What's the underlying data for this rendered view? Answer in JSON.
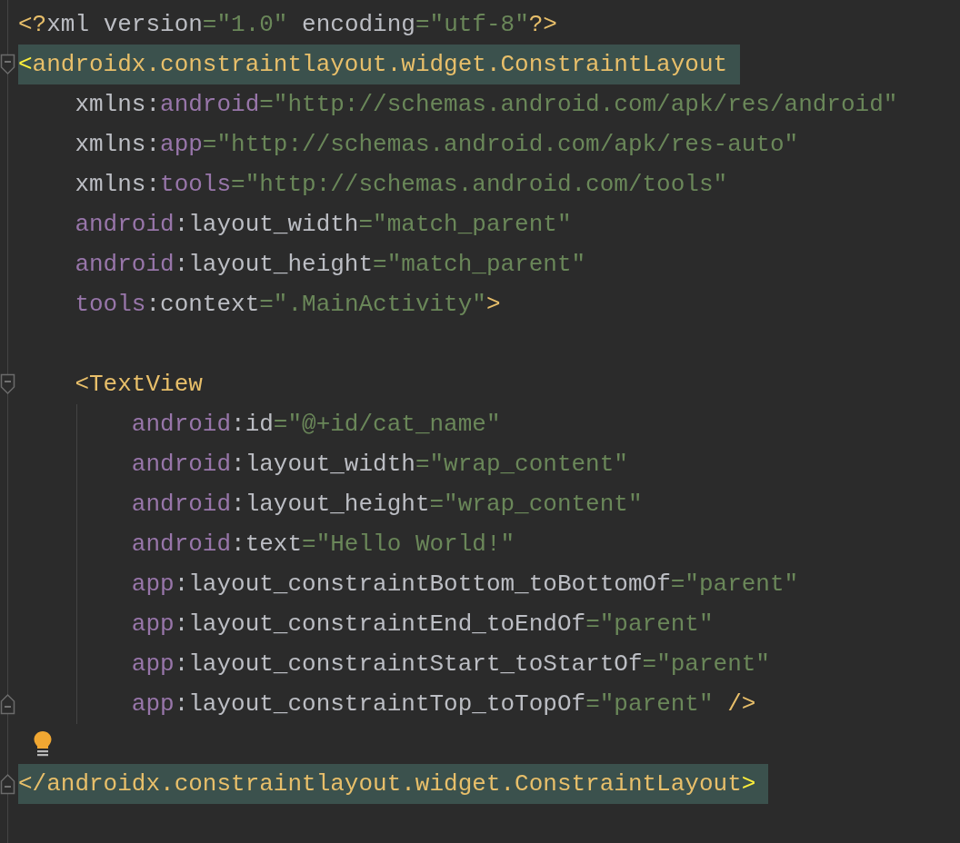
{
  "lines": [
    {
      "tokens": [
        {
          "kind": "tag",
          "text": "<?"
        },
        {
          "kind": "name",
          "text": "xml version"
        },
        {
          "kind": "value",
          "text": "=\"1.0\""
        },
        {
          "kind": "name",
          "text": " encoding"
        },
        {
          "kind": "value",
          "text": "=\"utf-8\""
        },
        {
          "kind": "tag",
          "text": "?>"
        }
      ],
      "highlighted": false,
      "kind": "plain"
    },
    {
      "tokens": [
        {
          "kind": "brace",
          "text": "<"
        },
        {
          "kind": "tag",
          "text": "androidx.constraintlayout.widget.ConstraintLayout"
        }
      ],
      "highlighted": true,
      "kind": "opening"
    },
    {
      "tokens": [
        {
          "kind": "name",
          "text": "    xmlns:"
        },
        {
          "kind": "ns",
          "text": "android"
        },
        {
          "kind": "value",
          "text": "=\"http://schemas.android.com/apk/res/android\""
        }
      ],
      "highlighted": false
    },
    {
      "tokens": [
        {
          "kind": "name",
          "text": "    xmlns:"
        },
        {
          "kind": "ns",
          "text": "app"
        },
        {
          "kind": "value",
          "text": "=\"http://schemas.android.com/apk/res-auto\""
        }
      ],
      "highlighted": false
    },
    {
      "tokens": [
        {
          "kind": "name",
          "text": "    xmlns:"
        },
        {
          "kind": "ns",
          "text": "tools"
        },
        {
          "kind": "value",
          "text": "=\"http://schemas.android.com/tools\""
        }
      ],
      "highlighted": false
    },
    {
      "tokens": [
        {
          "kind": "ns",
          "text": "    android"
        },
        {
          "kind": "name",
          "text": ":layout_width"
        },
        {
          "kind": "value",
          "text": "=\"match_parent\""
        }
      ],
      "highlighted": false
    },
    {
      "tokens": [
        {
          "kind": "ns",
          "text": "    android"
        },
        {
          "kind": "name",
          "text": ":layout_height"
        },
        {
          "kind": "value",
          "text": "=\"match_parent\""
        }
      ],
      "highlighted": false
    },
    {
      "tokens": [
        {
          "kind": "ns",
          "text": "    tools"
        },
        {
          "kind": "name",
          "text": ":context"
        },
        {
          "kind": "value",
          "text": "=\".MainActivity\""
        },
        {
          "kind": "tag",
          "text": ">"
        }
      ],
      "highlighted": false
    },
    {
      "highlighted": false
    },
    {
      "tokens": [
        {
          "kind": "tag",
          "text": "    <TextView"
        }
      ],
      "highlighted": false,
      "kind": "opening"
    },
    {
      "tokens": [
        {
          "kind": "ns",
          "text": "        android"
        },
        {
          "kind": "name",
          "text": ":id"
        },
        {
          "kind": "value",
          "text": "=\"@+id/cat_name\""
        }
      ],
      "highlighted": false
    },
    {
      "tokens": [
        {
          "kind": "ns",
          "text": "        android"
        },
        {
          "kind": "name",
          "text": ":layout_width"
        },
        {
          "kind": "value",
          "text": "=\"wrap_content\""
        }
      ],
      "highlighted": false
    },
    {
      "tokens": [
        {
          "kind": "ns",
          "text": "        android"
        },
        {
          "kind": "name",
          "text": ":layout_height"
        },
        {
          "kind": "value",
          "text": "=\"wrap_content\""
        }
      ],
      "highlighted": false
    },
    {
      "tokens": [
        {
          "kind": "ns",
          "text": "        android"
        },
        {
          "kind": "name",
          "text": ":text"
        },
        {
          "kind": "value",
          "text": "=\"Hello World!\""
        }
      ],
      "highlighted": false
    },
    {
      "tokens": [
        {
          "kind": "ns",
          "text": "        app"
        },
        {
          "kind": "name",
          "text": ":layout_constraintBottom_toBottomOf"
        },
        {
          "kind": "value",
          "text": "=\"parent\""
        }
      ],
      "highlighted": false
    },
    {
      "tokens": [
        {
          "kind": "ns",
          "text": "        app"
        },
        {
          "kind": "name",
          "text": ":layout_constraintEnd_toEndOf"
        },
        {
          "kind": "value",
          "text": "=\"parent\""
        }
      ],
      "highlighted": false
    },
    {
      "tokens": [
        {
          "kind": "ns",
          "text": "        app"
        },
        {
          "kind": "name",
          "text": ":layout_constraintStart_toStartOf"
        },
        {
          "kind": "value",
          "text": "=\"parent\""
        }
      ],
      "highlighted": false
    },
    {
      "tokens": [
        {
          "kind": "ns",
          "text": "        app"
        },
        {
          "kind": "name",
          "text": ":layout_constraintTop_toTopOf"
        },
        {
          "kind": "value",
          "text": "=\"parent\""
        },
        {
          "kind": "tag",
          "text": " />"
        }
      ],
      "highlighted": false,
      "kind": "closing"
    },
    {
      "highlighted": false,
      "hint": true
    },
    {
      "tokens": [
        {
          "kind": "tag",
          "text": "</androidx.constraintlayout.widget.ConstraintLayout"
        },
        {
          "kind": "brace",
          "text": ">"
        }
      ],
      "highlighted": true,
      "kind": "closing"
    }
  ]
}
